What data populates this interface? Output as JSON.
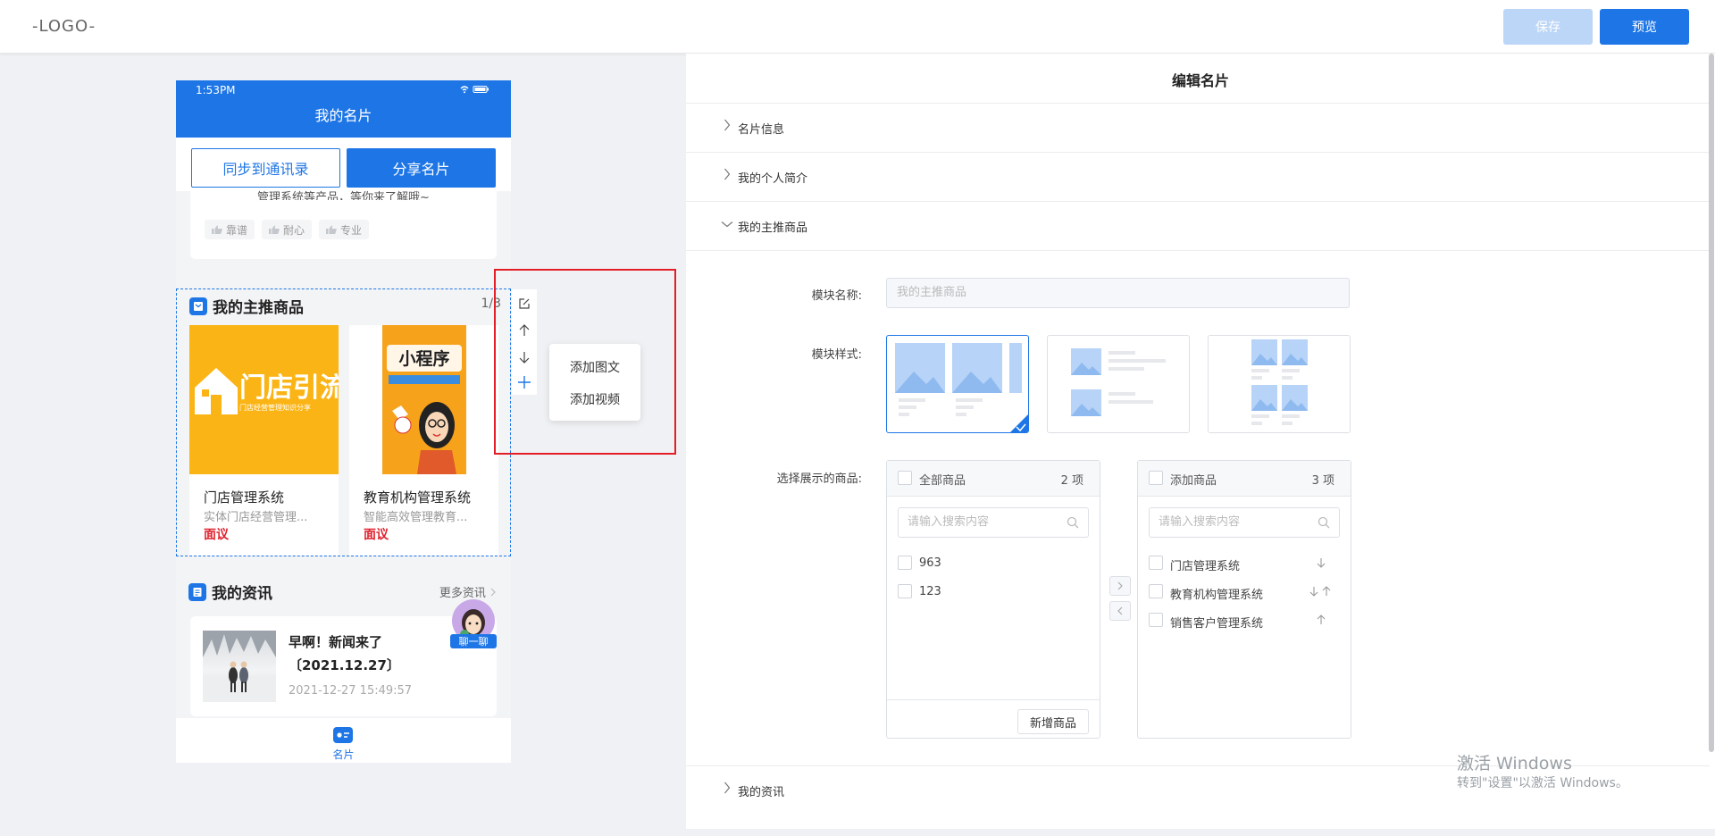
{
  "header": {
    "logo": "-LOGO-",
    "save_label": "保存",
    "preview_label": "预览"
  },
  "phone": {
    "status_time": "1:53PM",
    "title": "我的名片",
    "sync_label": "同步到通讯录",
    "share_label": "分享名片",
    "intro_text": "管理系统等产品，等你来了解哦~",
    "tags": [
      "靠谱",
      "耐心",
      "专业"
    ],
    "products": {
      "heading": "我的主推商品",
      "page": "1/3",
      "items": [
        {
          "name": "门店管理系统",
          "desc": "实体门店经营管理...",
          "price": "面议",
          "img_text": "门店引流",
          "img_sub": "门店经营管理知识分享"
        },
        {
          "name": "教育机构管理系统",
          "desc": "智能高效管理教育...",
          "price": "面议",
          "img_text": "小程序"
        }
      ]
    },
    "news": {
      "heading": "我的资讯",
      "more": "更多资讯",
      "item_title": "早啊！新闻来了〔2021.12.27〕",
      "item_date": "2021-12-27 15:49:57"
    },
    "chat_label": "聊一聊",
    "tab_label": "名片"
  },
  "popover": {
    "items": [
      "添加图文",
      "添加视频"
    ]
  },
  "editor": {
    "title": "编辑名片",
    "sections": [
      "名片信息",
      "我的个人简介",
      "我的主推商品",
      "我的资讯"
    ],
    "module_name_label": "模块名称:",
    "module_name_placeholder": "我的主推商品",
    "module_style_label": "模块样式:",
    "select_products_label": "选择展示的商品:",
    "left_box": {
      "title": "全部商品",
      "count": "2 项",
      "search_placeholder": "请输入搜索内容",
      "items": [
        "963",
        "123"
      ],
      "add_button": "新增商品"
    },
    "right_box": {
      "title": "添加商品",
      "count": "3 项",
      "search_placeholder": "请输入搜索内容",
      "items": [
        "门店管理系统",
        "教育机构管理系统",
        "销售客户管理系统"
      ]
    }
  },
  "watermark": {
    "line1": "激活 Windows",
    "line2": "转到\"设置\"以激活 Windows。"
  },
  "colors": {
    "primary": "#1e76e6",
    "highlight_box": "#e41e26",
    "price": "#e0222d"
  }
}
